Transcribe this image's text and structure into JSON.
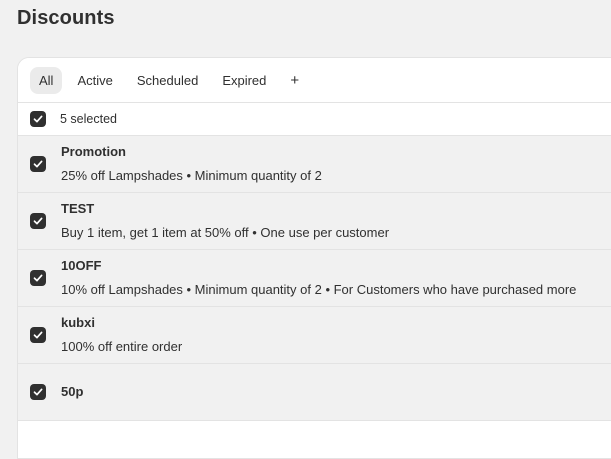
{
  "page": {
    "title": "Discounts"
  },
  "tabs": [
    {
      "label": "All"
    },
    {
      "label": "Active"
    },
    {
      "label": "Scheduled"
    },
    {
      "label": "Expired"
    },
    {
      "label": "+"
    }
  ],
  "bulk": {
    "selected_label": "5 selected"
  },
  "discounts": [
    {
      "title": "Promotion",
      "description": "25% off Lampshades • Minimum quantity of 2"
    },
    {
      "title": "TEST",
      "description": "Buy 1 item, get 1 item at 50% off • One use per customer"
    },
    {
      "title": "10OFF",
      "description": "10% off Lampshades • Minimum quantity of 2 • For Customers who have purchased more"
    },
    {
      "title": "kubxi",
      "description": "100% off entire order"
    },
    {
      "title": "50p",
      "description": ""
    }
  ],
  "colors": {
    "checkbox": "#303030",
    "selected_row": "#f1f1f1"
  }
}
